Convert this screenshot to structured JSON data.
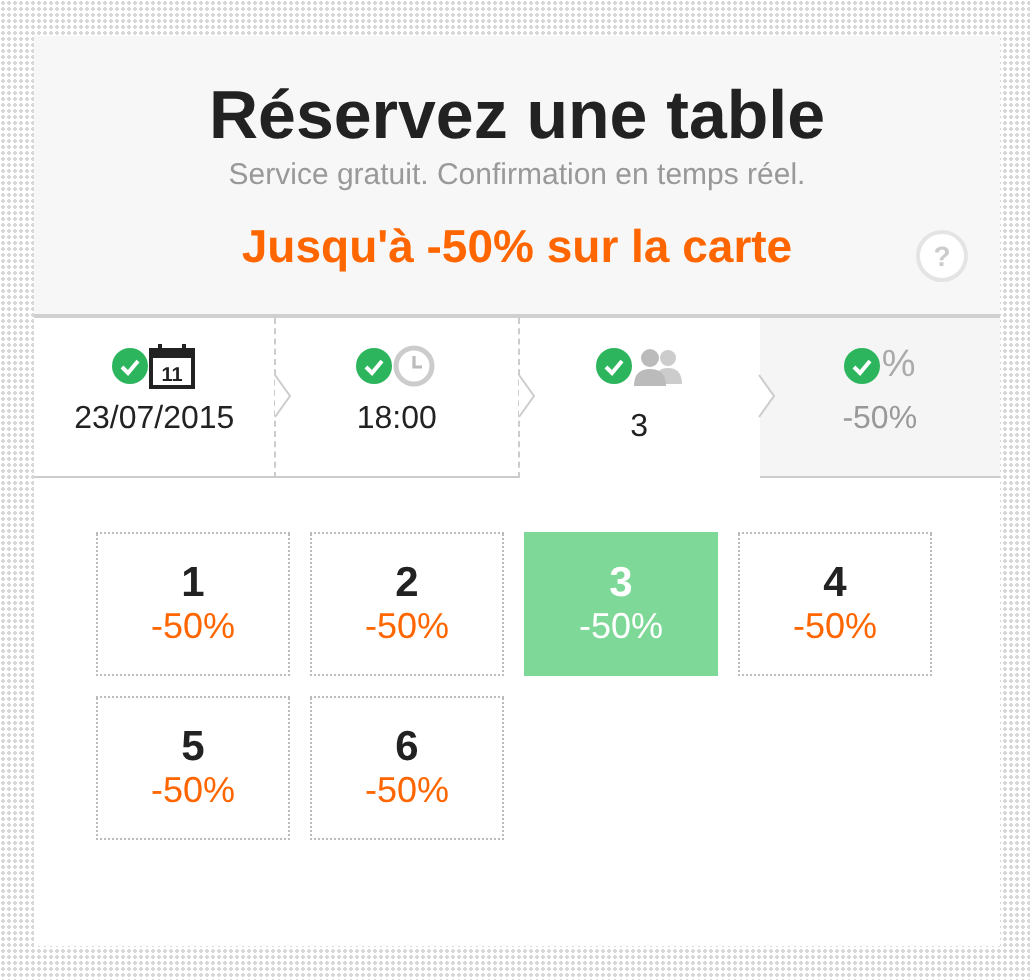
{
  "header": {
    "title": "Réservez une table",
    "subtitle": "Service gratuit. Confirmation en temps réel.",
    "promo": "Jusqu'à -50% sur la carte",
    "help": "?"
  },
  "steps": [
    {
      "kind": "date",
      "icon_text": "11",
      "value": "23/07/2015",
      "checked": true,
      "selected": false,
      "disabled": false
    },
    {
      "kind": "time",
      "value": "18:00",
      "checked": true,
      "selected": false,
      "disabled": false
    },
    {
      "kind": "people",
      "value": "3",
      "checked": true,
      "selected": true,
      "disabled": false
    },
    {
      "kind": "discount",
      "icon_text": "%",
      "value": "-50%",
      "checked": true,
      "selected": false,
      "disabled": true
    }
  ],
  "options": [
    {
      "number": "1",
      "discount": "-50%",
      "selected": false
    },
    {
      "number": "2",
      "discount": "-50%",
      "selected": false
    },
    {
      "number": "3",
      "discount": "-50%",
      "selected": true
    },
    {
      "number": "4",
      "discount": "-50%",
      "selected": false
    },
    {
      "number": "5",
      "discount": "-50%",
      "selected": false
    },
    {
      "number": "6",
      "discount": "-50%",
      "selected": false
    }
  ]
}
